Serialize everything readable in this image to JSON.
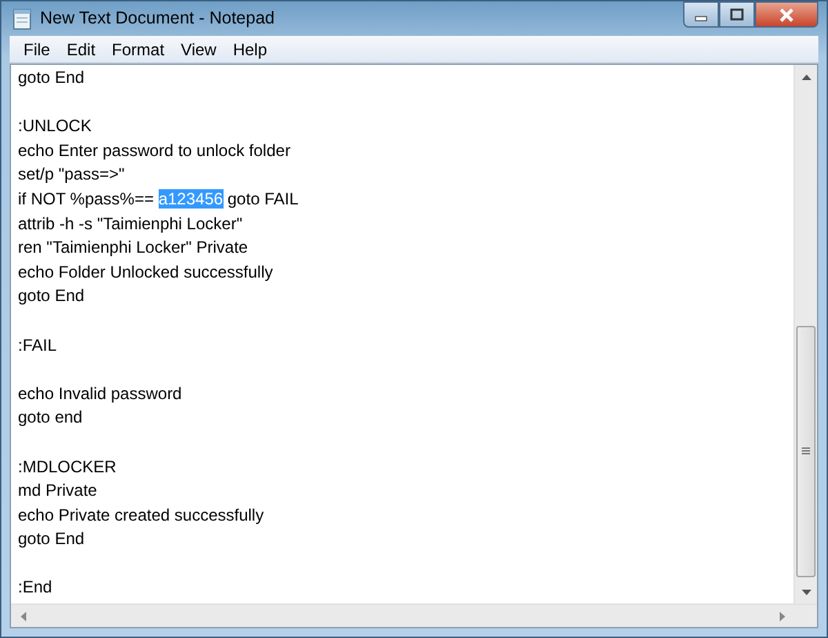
{
  "window": {
    "title": "New Text Document - Notepad"
  },
  "menu": [
    {
      "label": "File"
    },
    {
      "label": "Edit"
    },
    {
      "label": "Format"
    },
    {
      "label": "View"
    },
    {
      "label": "Help"
    }
  ],
  "editor": {
    "lines": [
      {
        "kind": "text",
        "text": "goto End"
      },
      {
        "kind": "blank"
      },
      {
        "kind": "text",
        "text": ":UNLOCK"
      },
      {
        "kind": "text",
        "text": "echo Enter password to unlock folder"
      },
      {
        "kind": "text",
        "text": "set/p \"pass=>\""
      },
      {
        "kind": "mixed",
        "segments": [
          {
            "text": "if NOT %pass%== ",
            "selected": false
          },
          {
            "text": "a123456",
            "selected": true
          },
          {
            "text": " goto FAIL",
            "selected": false
          }
        ]
      },
      {
        "kind": "text",
        "text": "attrib -h -s \"Taimienphi Locker\""
      },
      {
        "kind": "text",
        "text": "ren \"Taimienphi Locker\" Private"
      },
      {
        "kind": "text",
        "text": "echo Folder Unlocked successfully"
      },
      {
        "kind": "text",
        "text": "goto End"
      },
      {
        "kind": "blank"
      },
      {
        "kind": "text",
        "text": ":FAIL"
      },
      {
        "kind": "blank"
      },
      {
        "kind": "text",
        "text": "echo Invalid password"
      },
      {
        "kind": "text",
        "text": "goto end"
      },
      {
        "kind": "blank"
      },
      {
        "kind": "text",
        "text": ":MDLOCKER"
      },
      {
        "kind": "text",
        "text": "md Private"
      },
      {
        "kind": "text",
        "text": "echo Private created successfully"
      },
      {
        "kind": "text",
        "text": "goto End"
      },
      {
        "kind": "blank"
      },
      {
        "kind": "text",
        "text": ":End"
      }
    ]
  }
}
